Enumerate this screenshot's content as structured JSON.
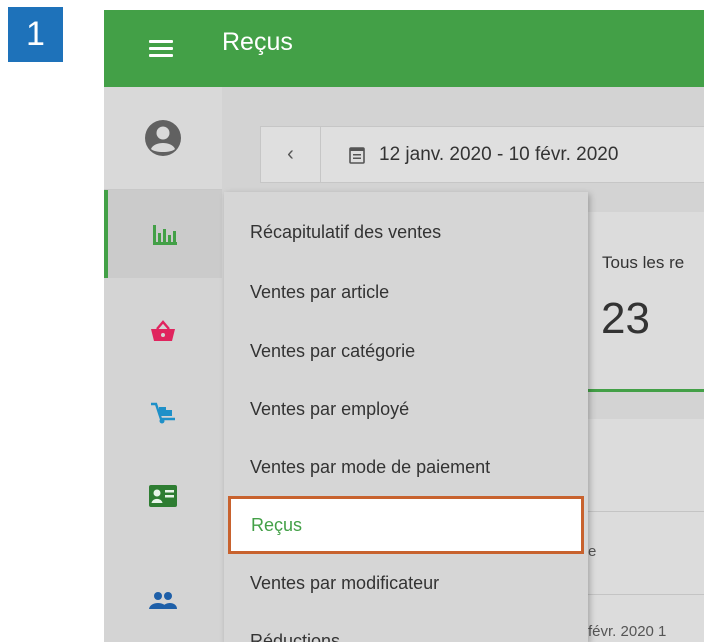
{
  "step_number": "1",
  "appbar": {
    "title": "Reçus"
  },
  "date_filter": {
    "range": "12 janv. 2020 - 10 févr. 2020"
  },
  "summary_card": {
    "label": "Tous les re",
    "value": "23"
  },
  "panel": {
    "fragment_1": "e",
    "fragment_2": "févr. 2020 1"
  },
  "reports_menu": {
    "items": [
      {
        "label": "Récapitulatif des ventes"
      },
      {
        "label": "Ventes par article"
      },
      {
        "label": "Ventes par catégorie"
      },
      {
        "label": "Ventes par employé"
      },
      {
        "label": "Ventes par mode de paiement"
      },
      {
        "label": "Reçus",
        "selected": true
      },
      {
        "label": "Ventes par modificateur"
      },
      {
        "label": "Réductions"
      }
    ]
  },
  "sidebar": {
    "items": [
      {
        "icon": "bar-chart-icon",
        "color": "#43a047",
        "active": true
      },
      {
        "icon": "shopping-basket-icon",
        "color": "#e0245e"
      },
      {
        "icon": "hand-truck-icon",
        "color": "#1e90c8"
      },
      {
        "icon": "employee-card-icon",
        "color": "#2e7d32"
      },
      {
        "icon": "customers-icon",
        "color": "#1e5fa8"
      }
    ]
  },
  "colors": {
    "accent": "#43a047",
    "highlight_border": "#c8622e",
    "badge": "#1e72ba"
  }
}
